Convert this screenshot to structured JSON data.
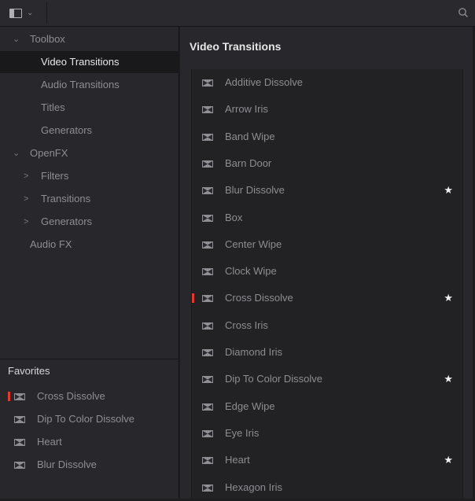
{
  "topbar": {
    "panel_icon": "panel-layout-icon",
    "search_icon": "search-icon"
  },
  "sidebar": {
    "items": [
      {
        "label": "Toolbox",
        "level": 0,
        "chevron": "⌄",
        "selected": false
      },
      {
        "label": "Video Transitions",
        "level": 1,
        "chevron": "",
        "selected": true
      },
      {
        "label": "Audio Transitions",
        "level": 1,
        "chevron": "",
        "selected": false
      },
      {
        "label": "Titles",
        "level": 1,
        "chevron": "",
        "selected": false
      },
      {
        "label": "Generators",
        "level": 1,
        "chevron": "",
        "selected": false
      },
      {
        "label": "OpenFX",
        "level": 0,
        "chevron": "⌄",
        "selected": false
      },
      {
        "label": "Filters",
        "level": 1,
        "chevron": ">",
        "selected": false
      },
      {
        "label": "Transitions",
        "level": 1,
        "chevron": ">",
        "selected": false
      },
      {
        "label": "Generators",
        "level": 1,
        "chevron": ">",
        "selected": false
      },
      {
        "label": "Audio FX",
        "level": 0,
        "chevron": "",
        "selected": false
      }
    ]
  },
  "favorites": {
    "title": "Favorites",
    "items": [
      {
        "label": "Cross Dissolve",
        "marked": true
      },
      {
        "label": "Dip To Color Dissolve",
        "marked": false
      },
      {
        "label": "Heart",
        "marked": false
      },
      {
        "label": "Blur Dissolve",
        "marked": false
      }
    ]
  },
  "main": {
    "title": "Video Transitions",
    "items": [
      {
        "label": "Additive Dissolve",
        "favorite": false,
        "marked": false
      },
      {
        "label": "Arrow Iris",
        "favorite": false,
        "marked": false
      },
      {
        "label": "Band Wipe",
        "favorite": false,
        "marked": false
      },
      {
        "label": "Barn Door",
        "favorite": false,
        "marked": false
      },
      {
        "label": "Blur Dissolve",
        "favorite": true,
        "marked": false
      },
      {
        "label": "Box",
        "favorite": false,
        "marked": false
      },
      {
        "label": "Center Wipe",
        "favorite": false,
        "marked": false
      },
      {
        "label": "Clock Wipe",
        "favorite": false,
        "marked": false
      },
      {
        "label": "Cross Dissolve",
        "favorite": true,
        "marked": true
      },
      {
        "label": "Cross Iris",
        "favorite": false,
        "marked": false
      },
      {
        "label": "Diamond Iris",
        "favorite": false,
        "marked": false
      },
      {
        "label": "Dip To Color Dissolve",
        "favorite": true,
        "marked": false
      },
      {
        "label": "Edge Wipe",
        "favorite": false,
        "marked": false
      },
      {
        "label": "Eye Iris",
        "favorite": false,
        "marked": false
      },
      {
        "label": "Heart",
        "favorite": true,
        "marked": false
      },
      {
        "label": "Hexagon Iris",
        "favorite": false,
        "marked": false
      }
    ]
  },
  "icons": {
    "transition": "transition-icon",
    "star": "★"
  },
  "colors": {
    "marker": "#e23a2e",
    "selected_bg": "#19191b",
    "accent_text": "#e8e8ea"
  }
}
